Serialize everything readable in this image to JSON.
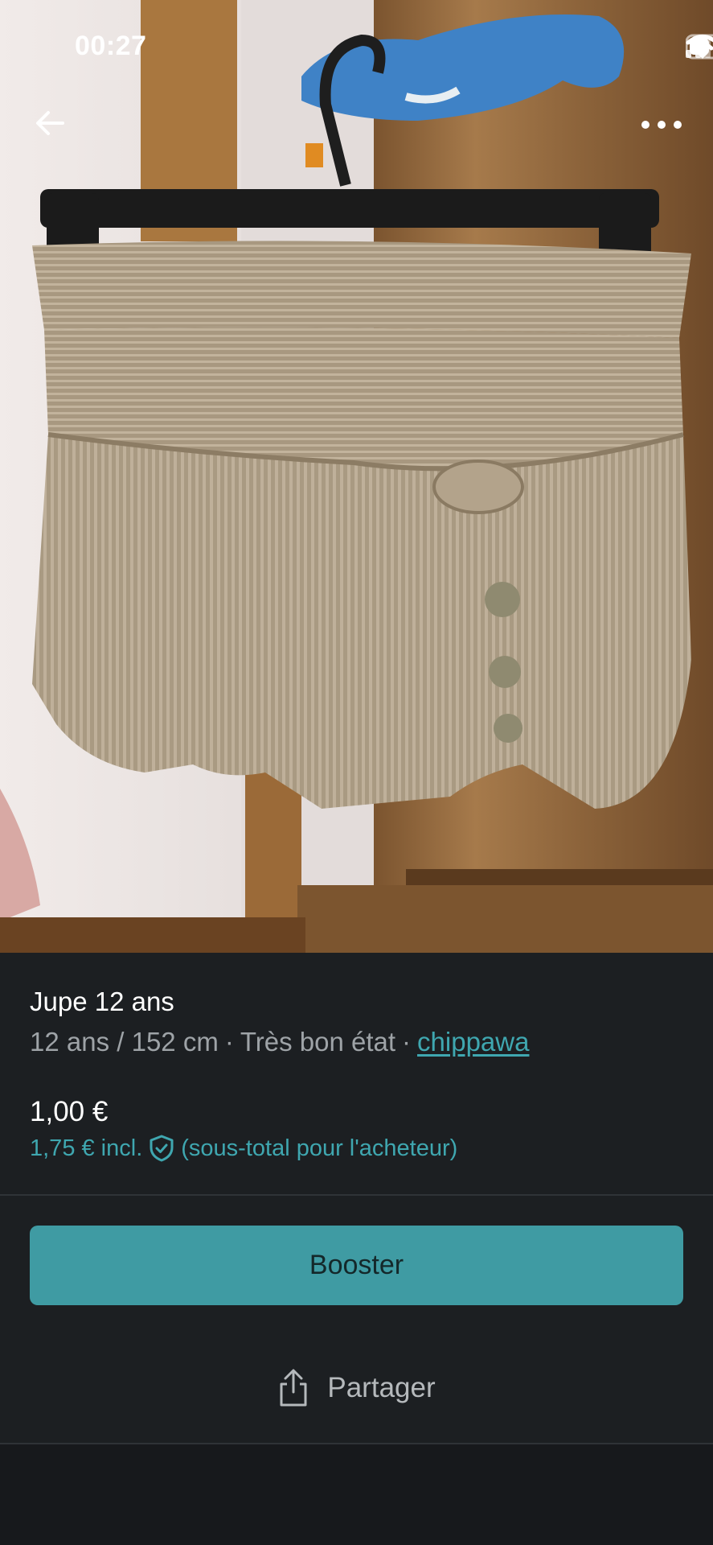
{
  "status_bar": {
    "time": "00:27"
  },
  "nav": {
    "back_icon": "arrow-left-icon",
    "more_icon": "more-horizontal-icon"
  },
  "photo": {
    "subject": "skirt-photo"
  },
  "listing": {
    "title": "Jupe 12 ans",
    "size": "12 ans / 152 cm",
    "separator": "·",
    "condition": "Très bon état",
    "seller": "chippawa",
    "price": "1,00 €",
    "price_incl": "1,75 € incl.",
    "price_incl_note": "(sous-total pour l'acheteur)"
  },
  "actions": {
    "booster_label": "Booster",
    "share_label": "Partager"
  },
  "colors": {
    "background": "#1c1f22",
    "accent": "#3fa7b0",
    "button": "#3f9ba3"
  }
}
